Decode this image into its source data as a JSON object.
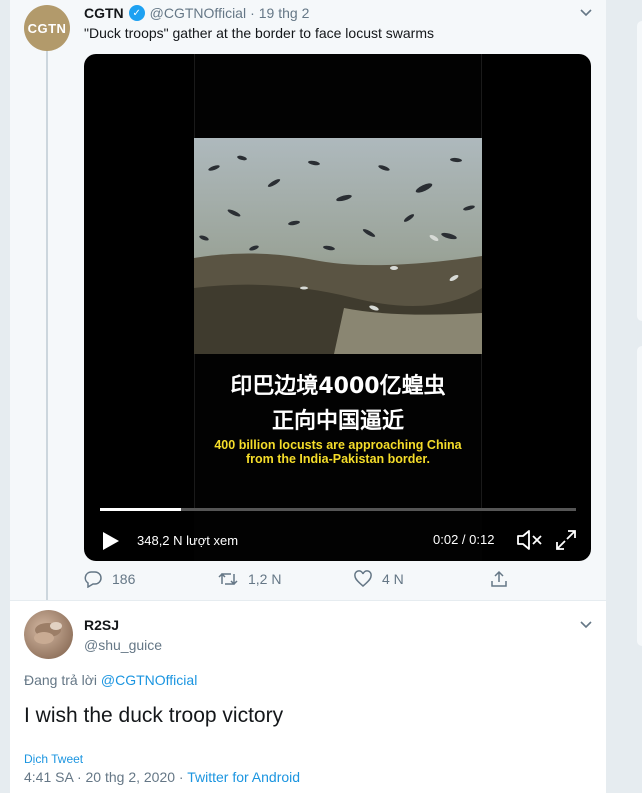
{
  "quoted_tweet": {
    "avatar_text": "CGTN",
    "name": "CGTN",
    "handle": "@CGTNOfficial",
    "separator": "·",
    "date": "19 thg 2",
    "text": "\"Duck troops\" gather at the border to face locust swarms",
    "video": {
      "caption_zh_line1": "印巴边境4000亿蝗虫",
      "caption_zh_line2": "正向中国逼近",
      "caption_en_line1": "400 billion locusts are approaching China",
      "caption_en_line2": "from the India-Pakistan border.",
      "views": "348,2 N lượt xem",
      "time": "0:02 / 0:12",
      "progress": 0.17
    },
    "actions": {
      "replies": "186",
      "retweets": "1,2 N",
      "likes": "4 N"
    }
  },
  "reply_tweet": {
    "name": "R2SJ",
    "handle": "@shu_guice",
    "replying_prefix": "Đang trả lời",
    "replying_to": "@CGTNOfficial",
    "text": "I wish the duck troop victory",
    "translate": "Dịch Tweet",
    "time": "4:41 SA",
    "date": "20 thg 2, 2020",
    "separator": "·",
    "source": "Twitter for Android"
  },
  "colors": {
    "accent": "#1da1f2",
    "link": "#1b95e0",
    "muted": "#657786",
    "caption_yellow": "#f5dd2a"
  }
}
